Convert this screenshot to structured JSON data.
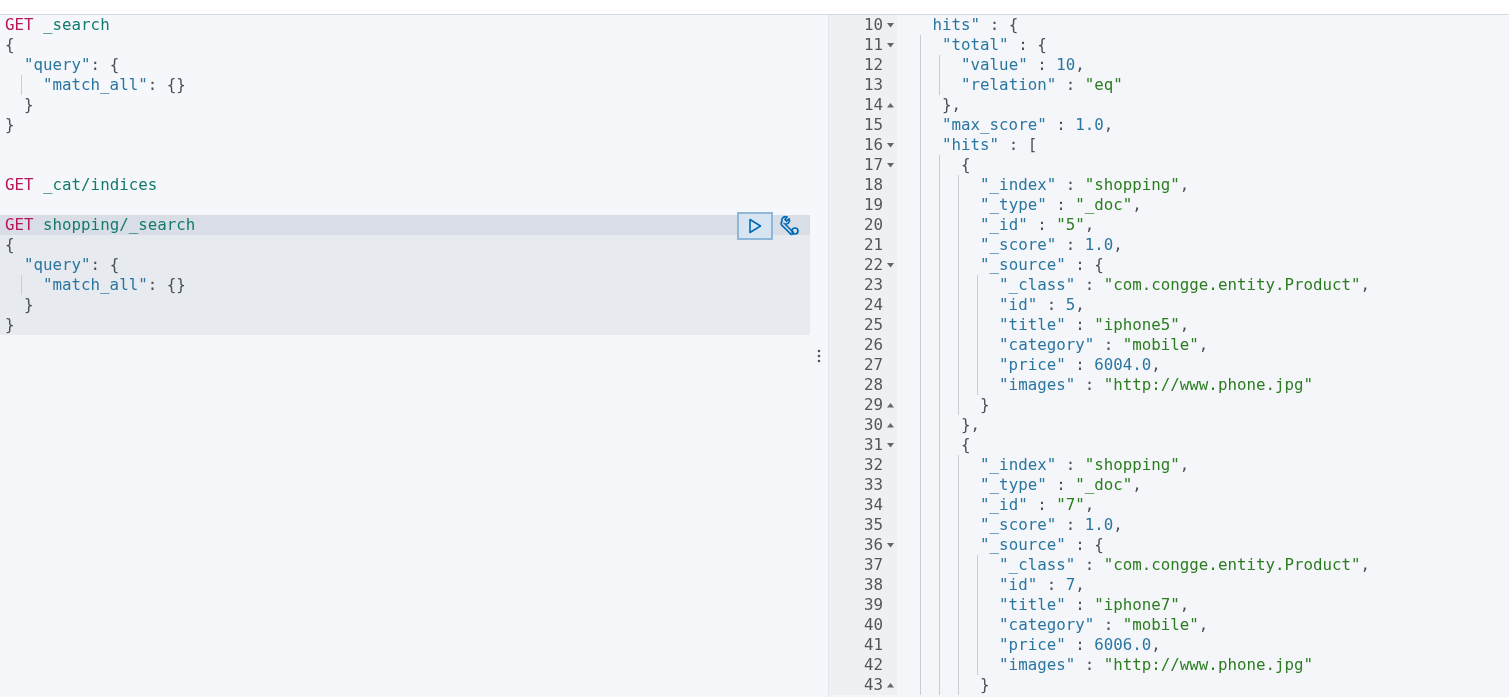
{
  "request_editor": {
    "requests": [
      {
        "selected": false,
        "lines": [
          {
            "kind": "request",
            "text": "GET _search"
          },
          {
            "kind": "body",
            "text": "{"
          },
          {
            "kind": "body",
            "text": "  \"query\": {"
          },
          {
            "kind": "body",
            "text": "    \"match_all\": {}"
          },
          {
            "kind": "body",
            "text": "  }"
          },
          {
            "kind": "body",
            "text": "}"
          },
          {
            "kind": "blank"
          },
          {
            "kind": "blank"
          }
        ]
      },
      {
        "selected": false,
        "lines": [
          {
            "kind": "request",
            "text": "GET _cat/indices"
          },
          {
            "kind": "blank"
          }
        ]
      },
      {
        "selected": true,
        "lines": [
          {
            "kind": "request",
            "text": "GET shopping/_search"
          },
          {
            "kind": "body",
            "text": "{"
          },
          {
            "kind": "body",
            "text": "  \"query\": {"
          },
          {
            "kind": "body",
            "text": "    \"match_all\": {}"
          },
          {
            "kind": "body",
            "text": "  }"
          },
          {
            "kind": "body",
            "text": "}"
          }
        ]
      }
    ]
  },
  "response": {
    "lines": [
      {
        "number": "10",
        "fold_start": true,
        "fold_end": false,
        "text": "   hits\" : {"
      },
      {
        "number": "11",
        "fold_start": true,
        "fold_end": false,
        "text": "    \"total\" : {"
      },
      {
        "number": "12",
        "fold_start": false,
        "fold_end": false,
        "text": "      \"value\" : 10,"
      },
      {
        "number": "13",
        "fold_start": false,
        "fold_end": false,
        "text": "      \"relation\" : \"eq\""
      },
      {
        "number": "14",
        "fold_start": false,
        "fold_end": true,
        "text": "    },"
      },
      {
        "number": "15",
        "fold_start": false,
        "fold_end": false,
        "text": "    \"max_score\" : 1.0,"
      },
      {
        "number": "16",
        "fold_start": true,
        "fold_end": false,
        "text": "    \"hits\" : ["
      },
      {
        "number": "17",
        "fold_start": true,
        "fold_end": false,
        "text": "      {"
      },
      {
        "number": "18",
        "fold_start": false,
        "fold_end": false,
        "text": "        \"_index\" : \"shopping\","
      },
      {
        "number": "19",
        "fold_start": false,
        "fold_end": false,
        "text": "        \"_type\" : \"_doc\","
      },
      {
        "number": "20",
        "fold_start": false,
        "fold_end": false,
        "text": "        \"_id\" : \"5\","
      },
      {
        "number": "21",
        "fold_start": false,
        "fold_end": false,
        "text": "        \"_score\" : 1.0,"
      },
      {
        "number": "22",
        "fold_start": true,
        "fold_end": false,
        "text": "        \"_source\" : {"
      },
      {
        "number": "23",
        "fold_start": false,
        "fold_end": false,
        "text": "          \"_class\" : \"com.congge.entity.Product\","
      },
      {
        "number": "24",
        "fold_start": false,
        "fold_end": false,
        "text": "          \"id\" : 5,"
      },
      {
        "number": "25",
        "fold_start": false,
        "fold_end": false,
        "text": "          \"title\" : \"iphone5\","
      },
      {
        "number": "26",
        "fold_start": false,
        "fold_end": false,
        "text": "          \"category\" : \"mobile\","
      },
      {
        "number": "27",
        "fold_start": false,
        "fold_end": false,
        "text": "          \"price\" : 6004.0,"
      },
      {
        "number": "28",
        "fold_start": false,
        "fold_end": false,
        "text": "          \"images\" : \"http://www.phone.jpg\""
      },
      {
        "number": "29",
        "fold_start": false,
        "fold_end": true,
        "text": "        }"
      },
      {
        "number": "30",
        "fold_start": false,
        "fold_end": true,
        "text": "      },"
      },
      {
        "number": "31",
        "fold_start": true,
        "fold_end": false,
        "text": "      {"
      },
      {
        "number": "32",
        "fold_start": false,
        "fold_end": false,
        "text": "        \"_index\" : \"shopping\","
      },
      {
        "number": "33",
        "fold_start": false,
        "fold_end": false,
        "text": "        \"_type\" : \"_doc\","
      },
      {
        "number": "34",
        "fold_start": false,
        "fold_end": false,
        "text": "        \"_id\" : \"7\","
      },
      {
        "number": "35",
        "fold_start": false,
        "fold_end": false,
        "text": "        \"_score\" : 1.0,"
      },
      {
        "number": "36",
        "fold_start": true,
        "fold_end": false,
        "text": "        \"_source\" : {"
      },
      {
        "number": "37",
        "fold_start": false,
        "fold_end": false,
        "text": "          \"_class\" : \"com.congge.entity.Product\","
      },
      {
        "number": "38",
        "fold_start": false,
        "fold_end": false,
        "text": "          \"id\" : 7,"
      },
      {
        "number": "39",
        "fold_start": false,
        "fold_end": false,
        "text": "          \"title\" : \"iphone7\","
      },
      {
        "number": "40",
        "fold_start": false,
        "fold_end": false,
        "text": "          \"category\" : \"mobile\","
      },
      {
        "number": "41",
        "fold_start": false,
        "fold_end": false,
        "text": "          \"price\" : 6006.0,"
      },
      {
        "number": "42",
        "fold_start": false,
        "fold_end": false,
        "text": "          \"images\" : \"http://www.phone.jpg\""
      },
      {
        "number": "43",
        "fold_start": false,
        "fold_end": true,
        "text": "        }"
      }
    ]
  }
}
